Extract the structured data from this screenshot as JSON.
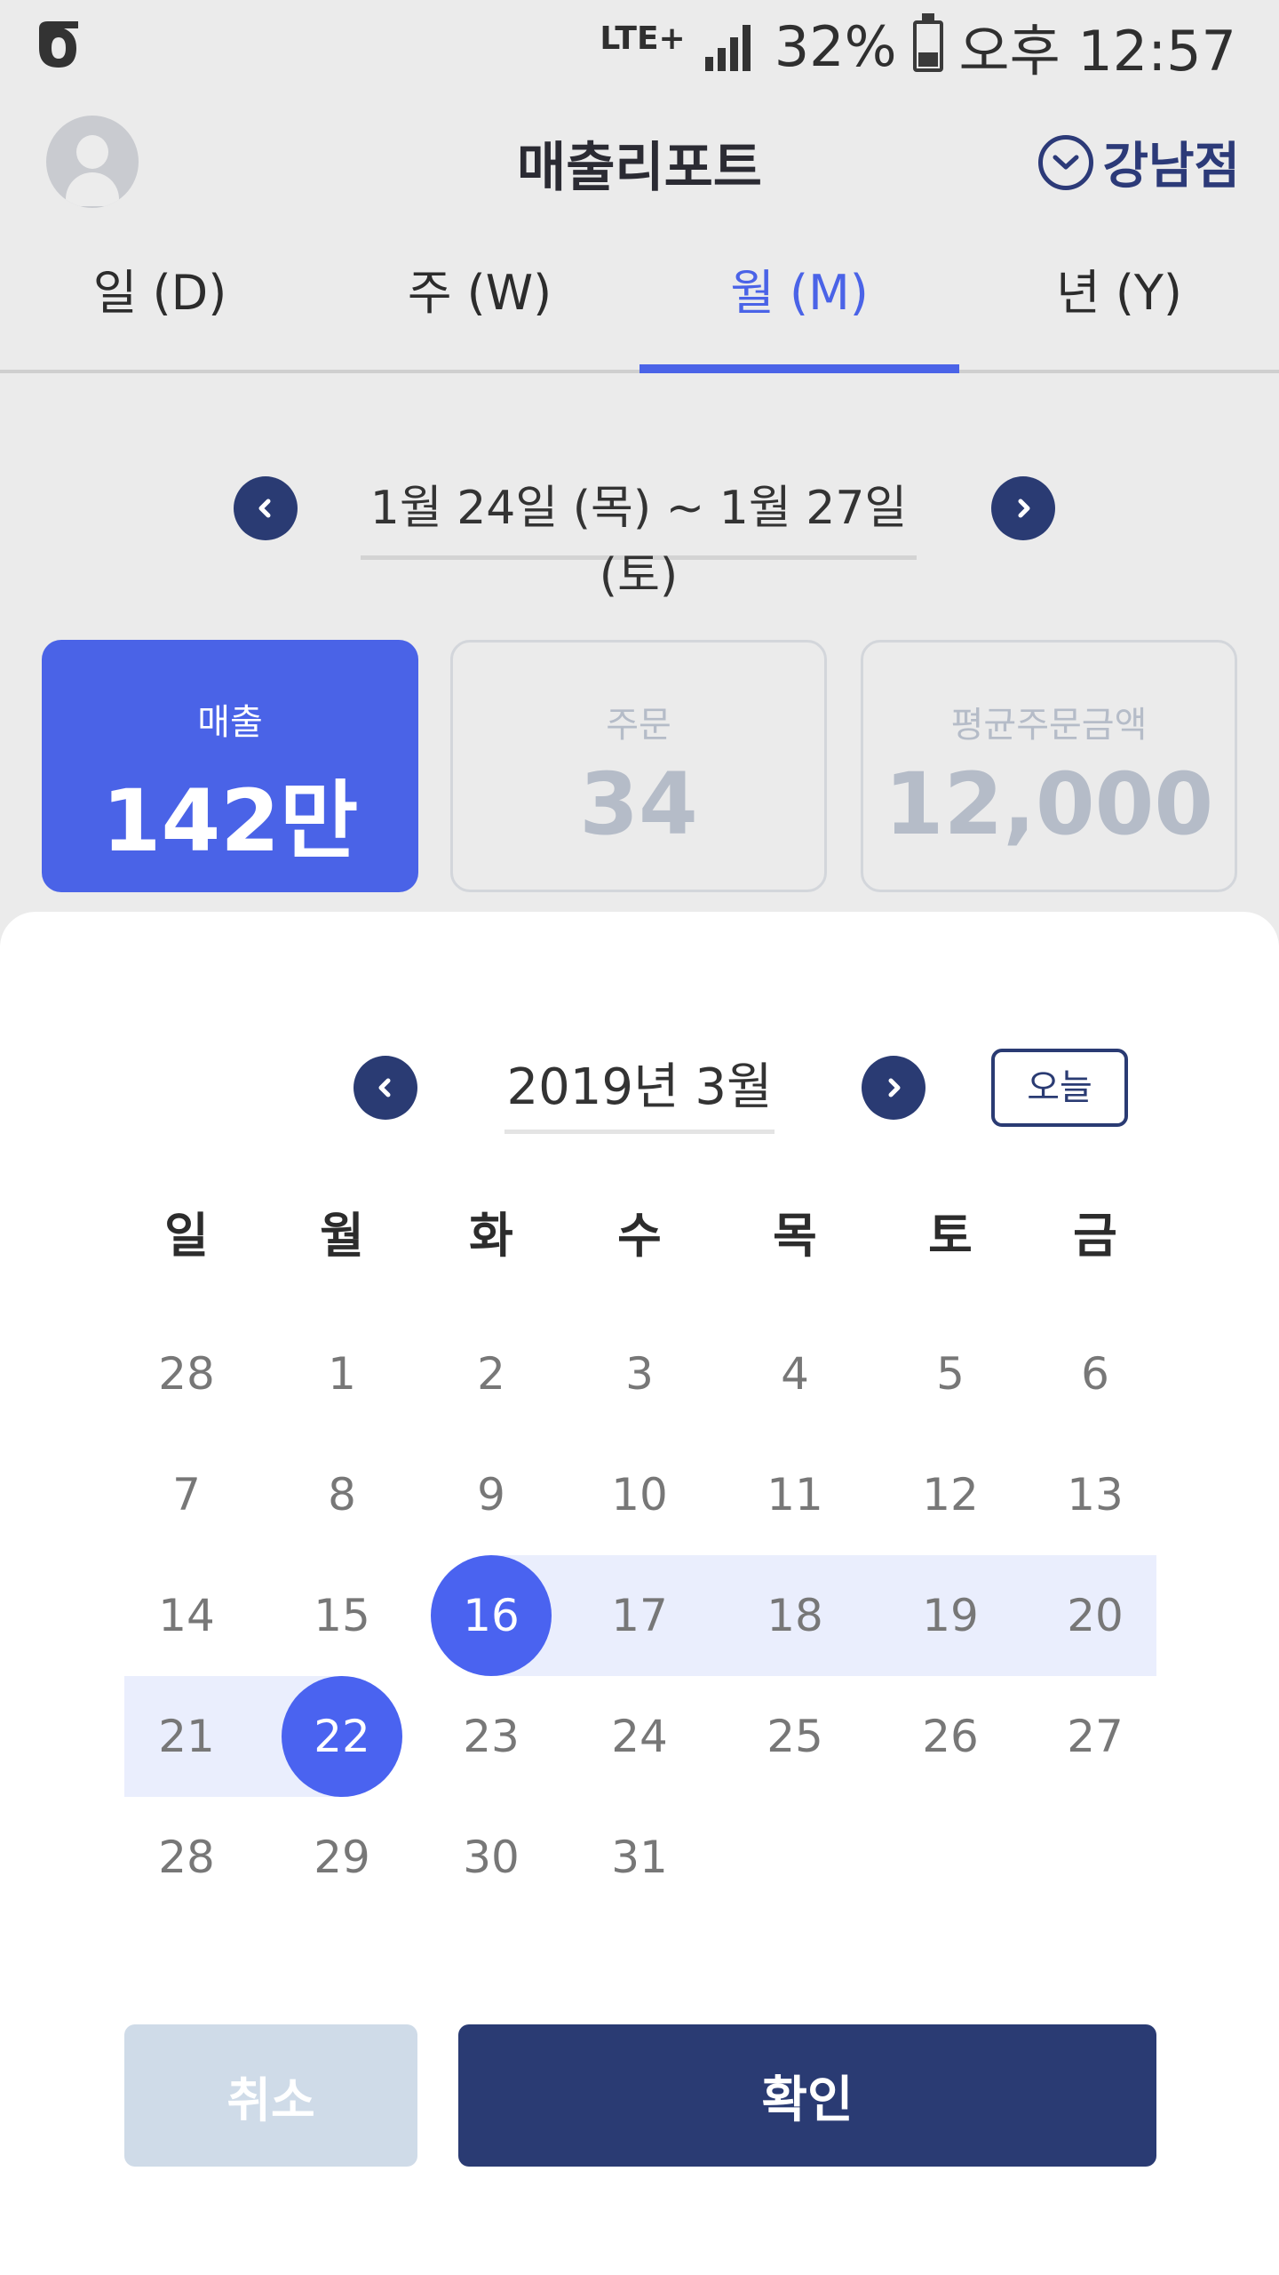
{
  "status_bar": {
    "network": "LTE+",
    "battery": "32%",
    "battery_level": 0.32,
    "time": "오후 12:57"
  },
  "header": {
    "title": "매출리포트",
    "branch": "강남점"
  },
  "tabs": [
    {
      "label": "일 (D)",
      "active": false
    },
    {
      "label": "주 (W)",
      "active": false
    },
    {
      "label": "월 (M)",
      "active": true
    },
    {
      "label": "년 (Y)",
      "active": false
    }
  ],
  "range": {
    "label": "1월  24일 (목) ~ 1월 27일 (토)"
  },
  "cards": {
    "sales": {
      "caption": "매출",
      "value": "142만"
    },
    "orders": {
      "caption": "주문",
      "value": "34"
    },
    "avg": {
      "caption": "평균주문금액",
      "value": "12,000"
    }
  },
  "calendar": {
    "month_label": "2019년 3월",
    "today_label": "오늘",
    "weekdays": [
      "일",
      "월",
      "화",
      "수",
      "목",
      "토",
      "금"
    ],
    "weeks": [
      [
        "28",
        "1",
        "2",
        "3",
        "4",
        "5",
        "6"
      ],
      [
        "7",
        "8",
        "9",
        "10",
        "11",
        "12",
        "13"
      ],
      [
        "14",
        "15",
        "16",
        "17",
        "18",
        "19",
        "20"
      ],
      [
        "21",
        "22",
        "23",
        "24",
        "25",
        "26",
        "27"
      ],
      [
        "28",
        "29",
        "30",
        "31"
      ]
    ],
    "selected_start": "16",
    "selected_end": "22"
  },
  "actions": {
    "cancel": "취소",
    "confirm": "확인"
  },
  "colors": {
    "accent": "#4a63e7",
    "navy": "#2a3b73",
    "range_highlight": "#eaeefd"
  }
}
